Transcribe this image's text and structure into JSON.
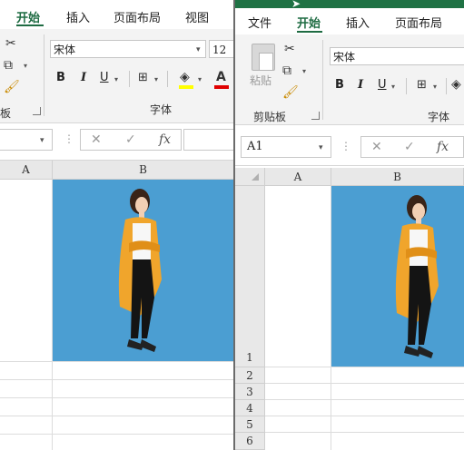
{
  "left_window": {
    "tabs": [
      "开始",
      "插入",
      "页面布局",
      "视图"
    ],
    "active_tab": "开始",
    "font_name": "宋体",
    "font_size": "12",
    "partial_group_label": "板",
    "font_group_label": "字体",
    "bold": "B",
    "italic": "I",
    "underline": "U",
    "fx": "fx",
    "columns": [
      "A",
      "B"
    ]
  },
  "right_window": {
    "tabs": [
      "文件",
      "开始",
      "插入",
      "页面布局"
    ],
    "active_tab": "开始",
    "paste_label": "粘贴",
    "clipboard_group_label": "剪贴板",
    "font_name": "宋体",
    "font_group_label": "字体",
    "bold": "B",
    "italic": "I",
    "underline": "U",
    "name_box": "A1",
    "fx": "fx",
    "columns": [
      "A",
      "B"
    ],
    "rows": [
      "1",
      "2",
      "3",
      "4",
      "5",
      "6"
    ]
  },
  "colors": {
    "accent_green": "#1e6b42",
    "titlebar_green": "#1f7244",
    "photo_bg": "#4b9ed2",
    "highlight_yellow": "#ffff00",
    "font_red": "#e00000"
  }
}
